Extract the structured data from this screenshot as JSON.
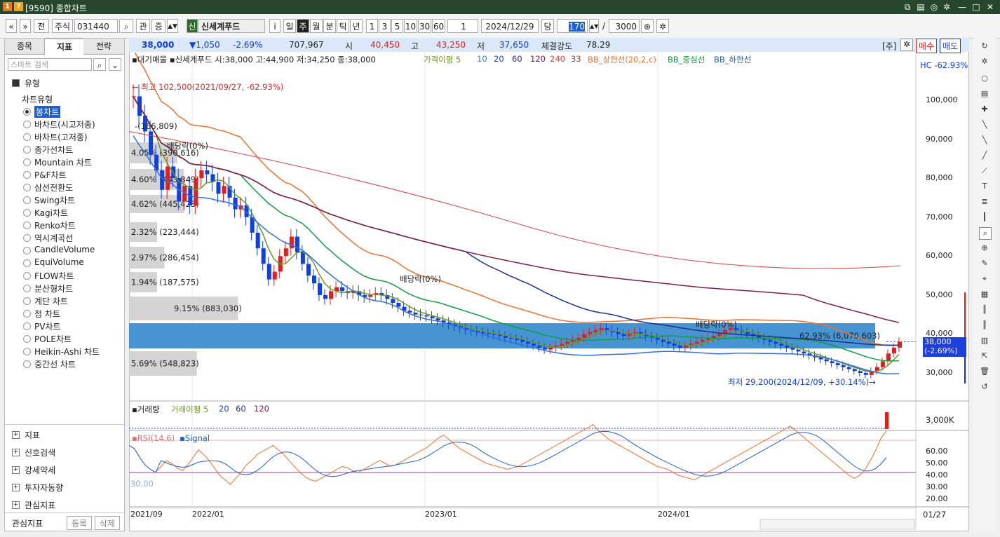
{
  "window": {
    "icon1": "1",
    "icon2": "?",
    "title": "[9590] 종합차트"
  },
  "toolbar": {
    "nav_prev": "«",
    "nav_down": "»",
    "type_label": "전",
    "stock_label": "주식",
    "code": "031440",
    "search_glyph": "⌕",
    "relation_label": "관",
    "sector_label": "증",
    "badge": "신",
    "stock_name": "신세계푸드",
    "info_label": "i",
    "periods": [
      "일",
      "주",
      "월",
      "분",
      "틱",
      "년"
    ],
    "active_period": "주",
    "intervals": [
      "1",
      "3",
      "5",
      "10",
      "30",
      "60"
    ],
    "count": "1",
    "date": "2024/12/29",
    "unit_label": "당",
    "bars": "170",
    "slash": "/",
    "total": "3000"
  },
  "left_panel": {
    "tabs": [
      "종목",
      "지표",
      "전략"
    ],
    "active_tab": "지표",
    "search_placeholder": "스마트 검색",
    "section_title": "유형",
    "tree_parent": "차트유형",
    "chart_types": [
      "봉차트",
      "바차트(시고저종)",
      "바차트(고저종)",
      "종가선차트",
      "Mountain 차트",
      "P&F차트",
      "삼선전환도",
      "Swing차트",
      "Kagi차트",
      "Renko차트",
      "역시계곡선",
      "CandleVolume",
      "EquiVolume",
      "FLOW차트",
      "분산형차트",
      "계단 차트",
      "점 차트",
      "PV차트",
      "POLE차트",
      "Heikin-Ashi 차트",
      "중간선 차트"
    ],
    "selected_type": "봉차트",
    "groups": [
      "지표",
      "신호검색",
      "강세약세",
      "투자자동향",
      "관심지표"
    ],
    "footer_label": "관심지표",
    "footer_register": "등록",
    "footer_delete": "삭제"
  },
  "infobar": {
    "price": "38,000",
    "change": "▼1,050",
    "change_pct": "-2.69%",
    "volume": "707,967",
    "open_label": "시",
    "open": "40,450",
    "high_label": "고",
    "high": "43,250",
    "low_label": "저",
    "low": "37,650",
    "strength_label": "체결강도",
    "strength": "78.29",
    "mode_label": "[주]",
    "buy_label": "매수",
    "sell_label": "매도"
  },
  "price_panel": {
    "legend_prefix": "▪대기매물 ▪신세계푸드 시:38,000 고:44,900 저:34,250 종:38,000",
    "ma_label": "가격이평 5",
    "ma_periods": [
      "10",
      "20",
      "60",
      "120",
      "240",
      "33"
    ],
    "bb_upper": "BB_상한선(20,2,c)",
    "bb_mid": "BB_중심선",
    "bb_lower": "BB_하한선",
    "right_header": "HC -62.93%",
    "high_annotation": "← 최고 102,500(2021/09/27, -62.93%)",
    "low_annotation": "최저 29,200(2024/12/09, +30.14%)→",
    "dividend_label": "배당락(0%)",
    "current_tag_price": "38,000",
    "current_tag_pct": "(-2.69%)",
    "y_ticks": [
      "100,000",
      "90,000",
      "80,000",
      "70,000",
      "60,000",
      "50,000",
      "40,000",
      "30,000"
    ],
    "volume_profile": [
      {
        "label": "4.05% (390,616)",
        "pct": 4.05
      },
      {
        "label": "4.60% (443,849)",
        "pct": 4.6
      },
      {
        "label": "4.62% (445,423)",
        "pct": 4.62
      },
      {
        "label": "2.32% (223,444)",
        "pct": 2.32
      },
      {
        "label": "2.97% (286,454)",
        "pct": 2.97
      },
      {
        "label": "1.94% (187,575)",
        "pct": 1.94
      },
      {
        "label": "9.15% (883,030)",
        "pct": 9.15
      },
      {
        "label": "62.93% (6,070,603)",
        "pct": 62.93
      },
      {
        "label": "5.69% (548,823)",
        "pct": 5.69
      }
    ],
    "profile_top": "-(166,809)"
  },
  "volume_panel": {
    "label": "▪거래량",
    "ma_label": "거래이평 5",
    "ma_periods": [
      "20",
      "60",
      "120"
    ],
    "tick": "3,000K"
  },
  "rsi_panel": {
    "label": "▪RSI(14,6)",
    "signal": "▪Signal",
    "level_label": "30.00",
    "y_ticks": [
      "60.00",
      "50.00",
      "40.00",
      "30.00",
      "20.00"
    ]
  },
  "x_axis": {
    "labels": [
      "2021/09",
      "2022/01",
      "2023/01",
      "2024/01"
    ],
    "right_label": "01/27"
  },
  "colors": {
    "up": "#e02020",
    "down": "#1040e0",
    "ma5": "#6a9a1f",
    "ma20": "#10a040",
    "ma60": "#203090",
    "bb_upper": "#f07030",
    "profile": "#3c8fd0"
  }
}
